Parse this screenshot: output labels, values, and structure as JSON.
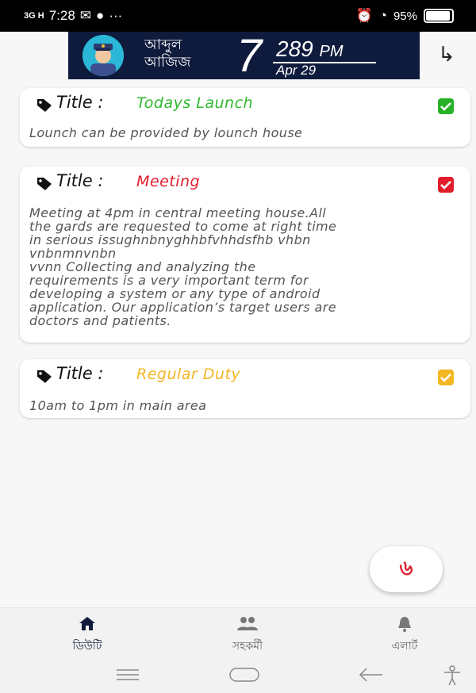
{
  "status_bar": {
    "network": "3G H",
    "time": "7:28",
    "battery": "95%"
  },
  "header": {
    "user_name_line1": "আব্দুল",
    "user_name_line2": "আজিজ",
    "day": "7",
    "time": "289",
    "ampm": "PM",
    "date": "Apr 29"
  },
  "cards": [
    {
      "title_label": "Title :",
      "title": "Todays Launch",
      "title_color": "#2fb82f",
      "check_color": "#27b127",
      "body": "Lounch can be provided by lounch house"
    },
    {
      "title_label": "Title :",
      "title": "Meeting",
      "title_color": "#e21d2b",
      "check_color": "#e21d2b",
      "body_lines": [
        "Meeting at 4pm in central meeting house.All",
        "the gards are requested to come at right time",
        "in serious issughnbnyghhbfvhhdsfhb vhbn",
        "vnbnmnvnbn",
        "vvnn Collecting and analyzing the",
        "requirements is a very important term for",
        "developing a system or any type of android",
        "application. Our application’s target users are",
        "doctors and patients."
      ]
    },
    {
      "title_label": "Title :",
      "title": "Regular Duty",
      "title_color": "#f2b722",
      "check_color": "#f2b722",
      "body": "10am to 1pm in main area"
    }
  ],
  "fab": {
    "glyph": "৬"
  },
  "bottom_nav": [
    {
      "label": "ডিউটি",
      "icon": "home-icon",
      "active": true
    },
    {
      "label": "সহকর্মী",
      "icon": "people-icon",
      "active": false
    },
    {
      "label": "এলার্ট",
      "icon": "bell-icon",
      "active": false
    }
  ],
  "system_nav": [
    "menu-icon",
    "home-pill-icon",
    "back-icon",
    "accessibility-icon"
  ]
}
